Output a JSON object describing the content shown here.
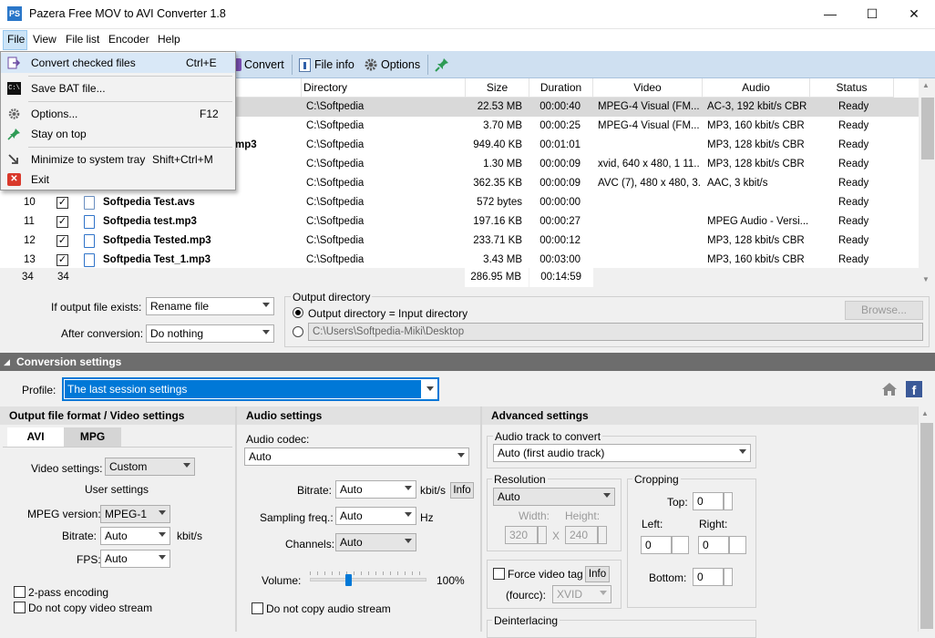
{
  "window": {
    "title": "Pazera Free MOV to AVI Converter 1.8",
    "minimize": "—",
    "maximize": "☐",
    "close": "✕",
    "app_icon": "PS"
  },
  "menubar": {
    "items": [
      "File",
      "View",
      "File list",
      "Encoder",
      "Help"
    ]
  },
  "toolbar": {
    "convert": "Convert",
    "file_info": "File info",
    "options": "Options"
  },
  "file_menu": {
    "items": [
      {
        "label": "Convert checked files",
        "shortcut": "Ctrl+E",
        "icon": "convert-icon"
      },
      {
        "label": "Save BAT file...",
        "shortcut": "",
        "icon": "bat-icon"
      },
      {
        "label": "Options...",
        "shortcut": "F12",
        "icon": "gear-icon"
      },
      {
        "label": "Stay on top",
        "shortcut": "",
        "icon": "pin-icon"
      },
      {
        "label": "Minimize to system tray",
        "shortcut": "Shift+Ctrl+M",
        "icon": "minimize-arrow-icon"
      },
      {
        "label": "Exit",
        "shortcut": "",
        "icon": "exit-icon"
      }
    ]
  },
  "filelist": {
    "columns": [
      "Directory",
      "Size",
      "Duration",
      "Video",
      "Audio",
      "Status"
    ],
    "rows": [
      {
        "num": "",
        "name": "",
        "dir": "C:\\Softpedia",
        "size": "22.53 MB",
        "dur": "00:00:40",
        "video": "MPEG-4 Visual (FM...",
        "audio": "AC-3, 192 kbit/s  CBR",
        "status": "Ready"
      },
      {
        "num": "",
        "name": "",
        "dir": "C:\\Softpedia",
        "size": "3.70 MB",
        "dur": "00:00:25",
        "video": "MPEG-4 Visual (FM...",
        "audio": "MP3, 160 kbit/s  CBR",
        "status": "Ready"
      },
      {
        "num": "",
        "name": "mp3",
        "dir": "C:\\Softpedia",
        "size": "949.40 KB",
        "dur": "00:01:01",
        "video": "",
        "audio": "MP3, 128 kbit/s  CBR",
        "status": "Ready"
      },
      {
        "num": "",
        "name": "",
        "dir": "C:\\Softpedia",
        "size": "1.30 MB",
        "dur": "00:00:09",
        "video": "xvid, 640 x 480, 1 11...",
        "audio": "MP3, 128 kbit/s  CBR",
        "status": "Ready"
      },
      {
        "num": "",
        "name": "",
        "dir": "C:\\Softpedia",
        "size": "362.35 KB",
        "dur": "00:00:09",
        "video": "AVC (7), 480 x 480, 3...",
        "audio": "AAC, 3 kbit/s",
        "status": "Ready"
      },
      {
        "num": "10",
        "name": "Softpedia Test.avs",
        "dir": "C:\\Softpedia",
        "size": "572 bytes",
        "dur": "00:00:00",
        "video": "",
        "audio": "",
        "status": "Ready"
      },
      {
        "num": "11",
        "name": "Softpedia test.mp3",
        "dir": "C:\\Softpedia",
        "size": "197.16 KB",
        "dur": "00:00:27",
        "video": "",
        "audio": "MPEG Audio - Versi...",
        "status": "Ready"
      },
      {
        "num": "12",
        "name": "Softpedia Tested.mp3",
        "dir": "C:\\Softpedia",
        "size": "233.71 KB",
        "dur": "00:00:12",
        "video": "",
        "audio": "MP3, 128 kbit/s  CBR",
        "status": "Ready"
      },
      {
        "num": "13",
        "name": "Softpedia Test_1.mp3",
        "dir": "C:\\Softpedia",
        "size": "3.43 MB",
        "dur": "00:03:00",
        "video": "",
        "audio": "MP3, 160 kbit/s  CBR",
        "status": "Ready"
      }
    ],
    "summary": {
      "count1": "34",
      "count2": "34",
      "size": "286.95 MB",
      "dur": "00:14:59"
    }
  },
  "output": {
    "if_exists_label": "If output file exists:",
    "if_exists_value": "Rename file",
    "after_label": "After conversion:",
    "after_value": "Do nothing",
    "dir_group": "Output directory",
    "radio_input": "Output directory = Input directory",
    "path": "C:\\Users\\Softpedia-Miki\\Desktop",
    "browse": "Browse..."
  },
  "conversion": {
    "section": "Conversion settings",
    "profile_label": "Profile:",
    "profile_value": "The last session settings"
  },
  "video_panel": {
    "header": "Output file format / Video settings",
    "tab_avi": "AVI",
    "tab_mpg": "MPG",
    "video_settings_label": "Video settings:",
    "video_settings_value": "Custom",
    "user_settings": "User settings",
    "mpeg_version_label": "MPEG version:",
    "mpeg_version_value": "MPEG-1",
    "bitrate_label": "Bitrate:",
    "bitrate_value": "Auto",
    "bitrate_unit": "kbit/s",
    "fps_label": "FPS:",
    "fps_value": "Auto",
    "two_pass": "2-pass encoding",
    "no_copy_video": "Do not copy video stream"
  },
  "audio_panel": {
    "header": "Audio settings",
    "codec_label": "Audio codec:",
    "codec_value": "Auto",
    "bitrate_label": "Bitrate:",
    "bitrate_value": "Auto",
    "bitrate_unit": "kbit/s",
    "info": "Info",
    "sampling_label": "Sampling freq.:",
    "sampling_value": "Auto",
    "sampling_unit": "Hz",
    "channels_label": "Channels:",
    "channels_value": "Auto",
    "volume_label": "Volume:",
    "volume_value": "100%",
    "volume_level": 0.33,
    "no_copy_audio": "Do not copy audio stream"
  },
  "advanced_panel": {
    "header": "Advanced settings",
    "track_group": "Audio track to convert",
    "track_value": "Auto (first audio track)",
    "resolution_group": "Resolution",
    "resolution_value": "Auto",
    "width_label": "Width:",
    "width_value": "320",
    "height_label": "Height:",
    "height_value": "240",
    "x_sep": "X",
    "cropping_group": "Cropping",
    "top_label": "Top:",
    "top_value": "0",
    "left_label": "Left:",
    "left_value": "0",
    "right_label": "Right:",
    "right_value": "0",
    "bottom_label": "Bottom:",
    "bottom_value": "0",
    "force_tag": "Force video tag",
    "info": "Info",
    "fourcc_label": "(fourcc):",
    "fourcc_value": "XVID",
    "deinterlacing": "Deinterlacing"
  }
}
